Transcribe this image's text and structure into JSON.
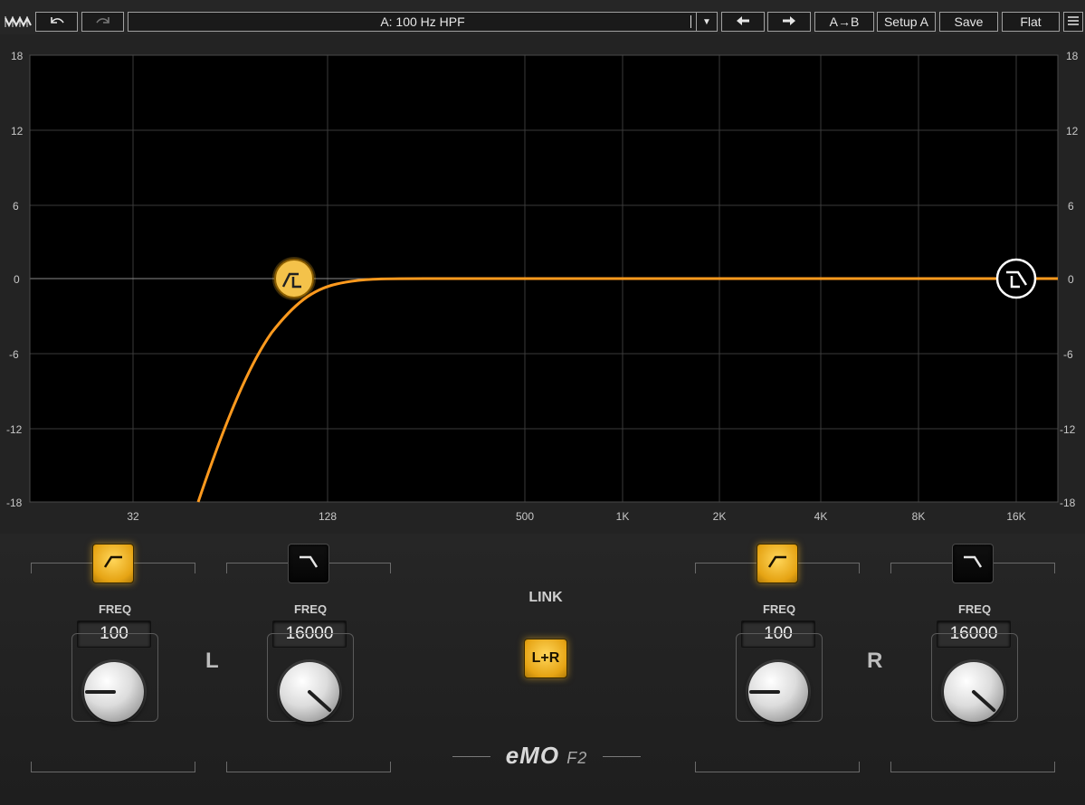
{
  "toolbar": {
    "undo_icon": "undo-icon",
    "redo_icon": "redo-icon",
    "preset_name": "A: 100 Hz HPF",
    "prev_icon": "arrow-left-icon",
    "next_icon": "arrow-right-icon",
    "ab_compare": "A→B",
    "setup": "Setup A",
    "save": "Save",
    "flat": "Flat",
    "menu_icon": "hamburger-icon"
  },
  "graph": {
    "y_ticks_left": [
      "18",
      "12",
      "6",
      "0",
      "-6",
      "-12",
      "-18"
    ],
    "y_ticks_right": [
      "18",
      "12",
      "6",
      "0",
      "-6",
      "-12",
      "-18"
    ],
    "x_ticks": [
      "32",
      "128",
      "500",
      "1K",
      "2K",
      "4K",
      "8K",
      "16K"
    ],
    "curve_color": "#ff9a1e",
    "hpf_marker_icon": "highpass-marker-icon",
    "lpf_marker_icon": "lowpass-marker-icon"
  },
  "left": {
    "label": "L",
    "hpf": {
      "freq_label": "FREQ",
      "freq_value": "100",
      "active": true
    },
    "lpf": {
      "freq_label": "FREQ",
      "freq_value": "16000",
      "active": false
    }
  },
  "link": {
    "label": "LINK",
    "button": "L+R",
    "active": true
  },
  "right": {
    "label": "R",
    "hpf": {
      "freq_label": "FREQ",
      "freq_value": "100",
      "active": true
    },
    "lpf": {
      "freq_label": "FREQ",
      "freq_value": "16000",
      "active": false
    }
  },
  "logo": {
    "main": "eMO",
    "sub": "F2"
  },
  "colors": {
    "accent": "#f2b01e",
    "curve": "#ff9a1e",
    "background": "#232323"
  }
}
